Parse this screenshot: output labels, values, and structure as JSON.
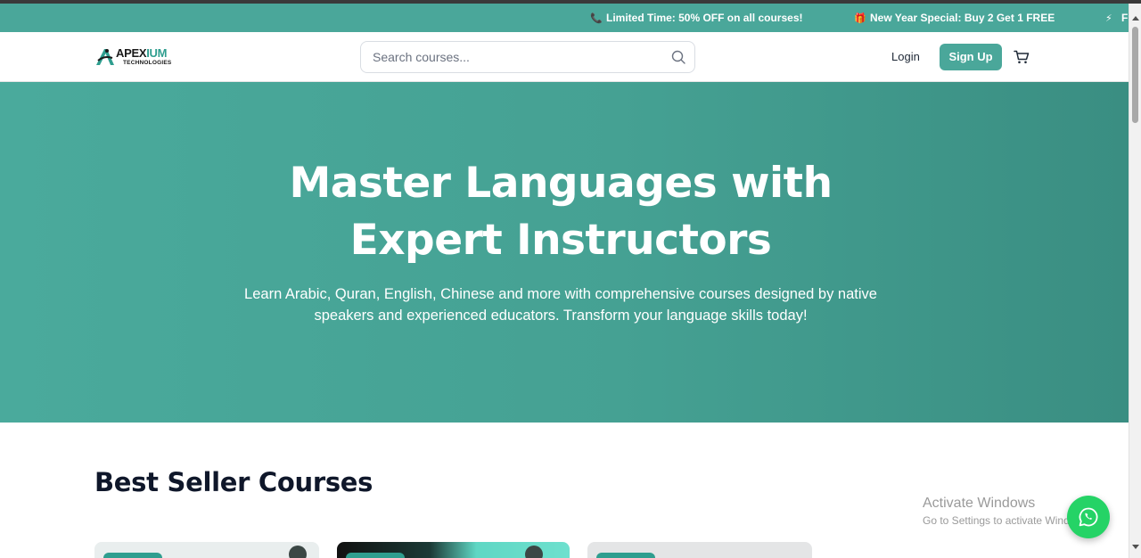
{
  "promo_bar": {
    "items": [
      {
        "icon": "phone-icon",
        "glyph": "📞",
        "text": "Limited Time: 50% OFF on all courses!"
      },
      {
        "icon": "gift-icon",
        "glyph": "🎁",
        "text": "New Year Special: Buy 2 Get 1 FREE"
      },
      {
        "icon": "lightning-icon",
        "glyph": "⚡",
        "text": "F"
      }
    ]
  },
  "header": {
    "logo": {
      "main_a": "APEX",
      "main_b": "IUM",
      "sub": "TECHNOLOGIES"
    },
    "search_placeholder": "Search courses...",
    "search_value": "",
    "login_label": "Login",
    "signup_label": "Sign Up"
  },
  "hero": {
    "title_line1": "Master Languages with",
    "title_line2": "Expert Instructors",
    "subtitle_line1": "Learn Arabic, Quran, English, Chinese and more with comprehensive courses designed by native",
    "subtitle_line2": "speakers and experienced educators. Transform your language skills today!"
  },
  "best_seller": {
    "title": "Best Seller Courses"
  },
  "overlay": {
    "activate_title": "Activate Windows",
    "activate_sub": "Go to Settings to activate Windows."
  },
  "colors": {
    "accent": "#4aa79a",
    "hero_bg": "#45a193",
    "title_text": "#0f172a",
    "whatsapp": "#25d366"
  }
}
